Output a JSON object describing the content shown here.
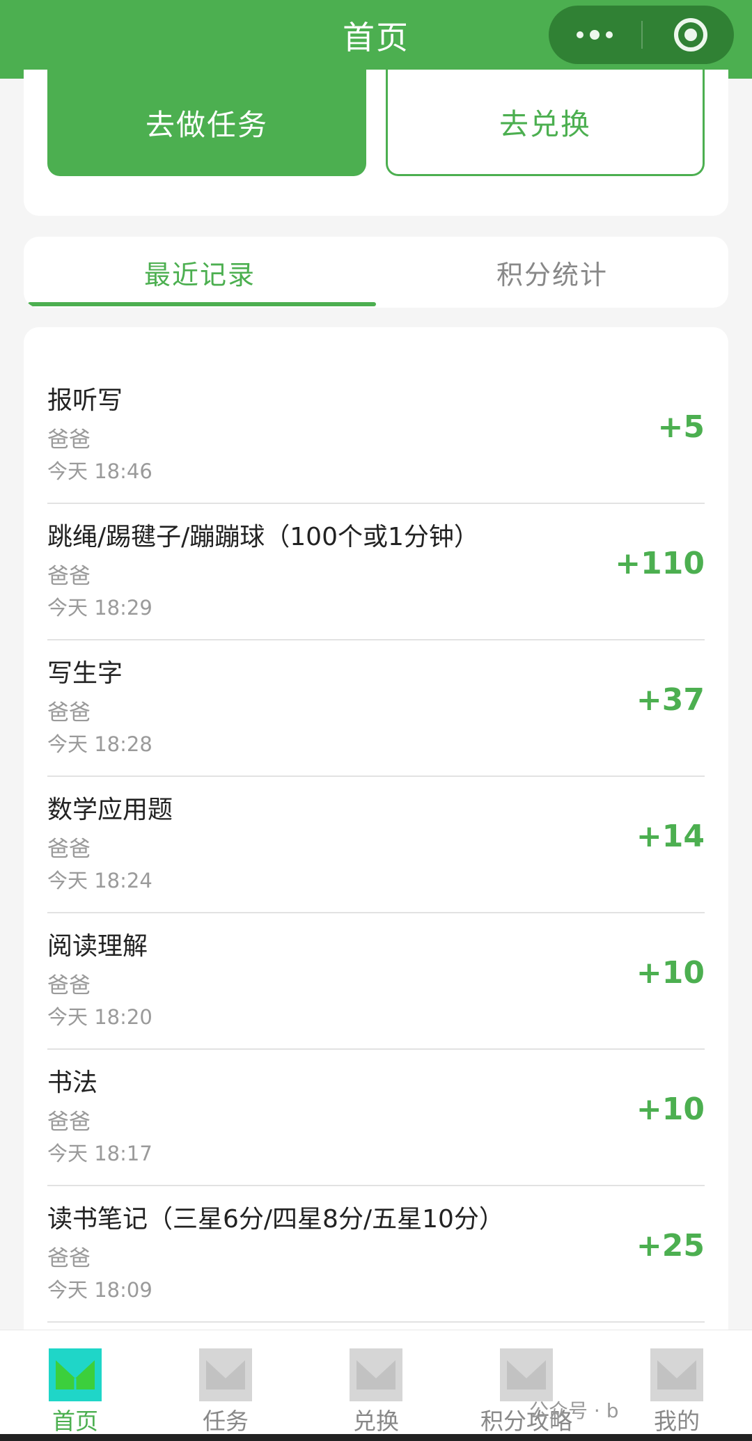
{
  "header": {
    "title": "首页"
  },
  "actions": {
    "task_label": "去做任务",
    "exchange_label": "去兑换"
  },
  "tabs": [
    {
      "label": "最近记录",
      "active": true
    },
    {
      "label": "积分统计",
      "active": false
    }
  ],
  "records": [
    {
      "title": "报听写",
      "user": "爸爸",
      "time": "今天 18:46",
      "points": "+5"
    },
    {
      "title": "跳绳/踢毽子/蹦蹦球（100个或1分钟）",
      "user": "爸爸",
      "time": "今天 18:29",
      "points": "+110"
    },
    {
      "title": "写生字",
      "user": "爸爸",
      "time": "今天 18:28",
      "points": "+37"
    },
    {
      "title": "数学应用题",
      "user": "爸爸",
      "time": "今天 18:24",
      "points": "+14"
    },
    {
      "title": "阅读理解",
      "user": "爸爸",
      "time": "今天 18:20",
      "points": "+10"
    },
    {
      "title": "书法",
      "user": "爸爸",
      "time": "今天 18:17",
      "points": "+10"
    },
    {
      "title": "读书笔记（三星6分/四星8分/五星10分）",
      "user": "爸爸",
      "time": "今天 18:09",
      "points": "+25"
    }
  ],
  "nav": [
    {
      "label": "首页",
      "icon": "home-icon",
      "active": true
    },
    {
      "label": "任务",
      "icon": "task-icon",
      "active": false
    },
    {
      "label": "兑换",
      "icon": "exchange-icon",
      "active": false
    },
    {
      "label": "积分攻略",
      "icon": "guide-icon",
      "active": false
    },
    {
      "label": "我的",
      "icon": "profile-icon",
      "active": false
    }
  ],
  "watermark": "公众号 · b",
  "colors": {
    "primary": "#4caf50",
    "active_icon": "#1fd6c8"
  }
}
